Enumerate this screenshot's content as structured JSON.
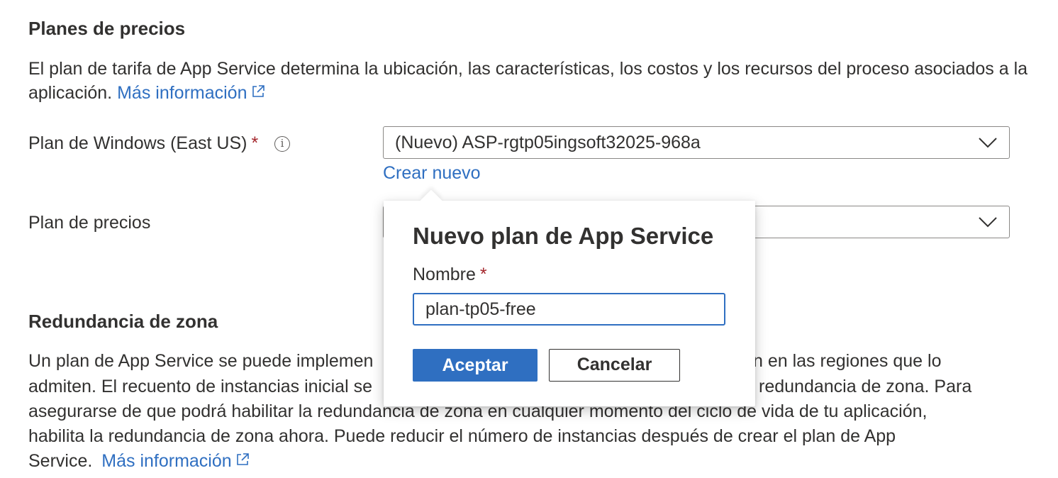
{
  "pricing": {
    "title": "Planes de precios",
    "description": "El plan de tarifa de App Service determina la ubicación, las características, los costos y los recursos del proceso asociados a la aplicación.",
    "learn_more": "Más información"
  },
  "windows_plan": {
    "label": "Plan de Windows (East US)",
    "required_mark": "*",
    "info_icon": "info-icon",
    "value": "(Nuevo) ASP-rgtp05ingsoft32025-968a",
    "create_new": "Crear nuevo"
  },
  "pricing_plan": {
    "label": "Plan de precios",
    "value": ""
  },
  "zone_redundancy": {
    "title": "Redundancia de zona",
    "line1_a": "Un plan de App Service se puede implemen",
    "line1_b": "n en las regiones que lo",
    "line2_a": "admiten. El recuento de instancias inicial se",
    "line2_b": "redundancia de zona. Para",
    "line3": "asegurarse de que podrá habilitar la redundancia de zona en cualquier momento del ciclo de vida de tu aplicación,",
    "line4": "habilita la redundancia de zona ahora. Puede reducir el número de instancias después de crear el plan de App",
    "line5": "Service.",
    "learn_more": "Más información"
  },
  "popup": {
    "title": "Nuevo plan de App Service",
    "name_label": "Nombre",
    "required_mark": "*",
    "name_value": "plan-tp05-free",
    "accept_label": "Aceptar",
    "cancel_label": "Cancelar"
  },
  "colors": {
    "link": "#2f6fc1",
    "text": "#323130",
    "required": "#a4262c",
    "primary_button": "#2f6fc1"
  }
}
